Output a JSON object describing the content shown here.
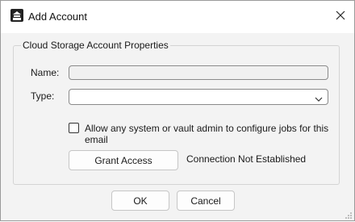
{
  "window": {
    "title": "Add Account",
    "app_icon": "vault-icon",
    "close_icon": "close-icon"
  },
  "group": {
    "title": "Cloud Storage Account Properties",
    "name_label": "Name:",
    "name_value": "",
    "type_label": "Type:",
    "type_value": "",
    "allow_admin_label": "Allow any system or vault admin to configure jobs for this email",
    "allow_admin_checked": false,
    "grant_access_label": "Grant Access",
    "connection_status": "Connection Not Established"
  },
  "buttons": {
    "ok": "OK",
    "cancel": "Cancel"
  },
  "colors": {
    "window_bg": "#f3f3f3",
    "titlebar_bg": "#ffffff",
    "border": "#8a8a8a"
  }
}
